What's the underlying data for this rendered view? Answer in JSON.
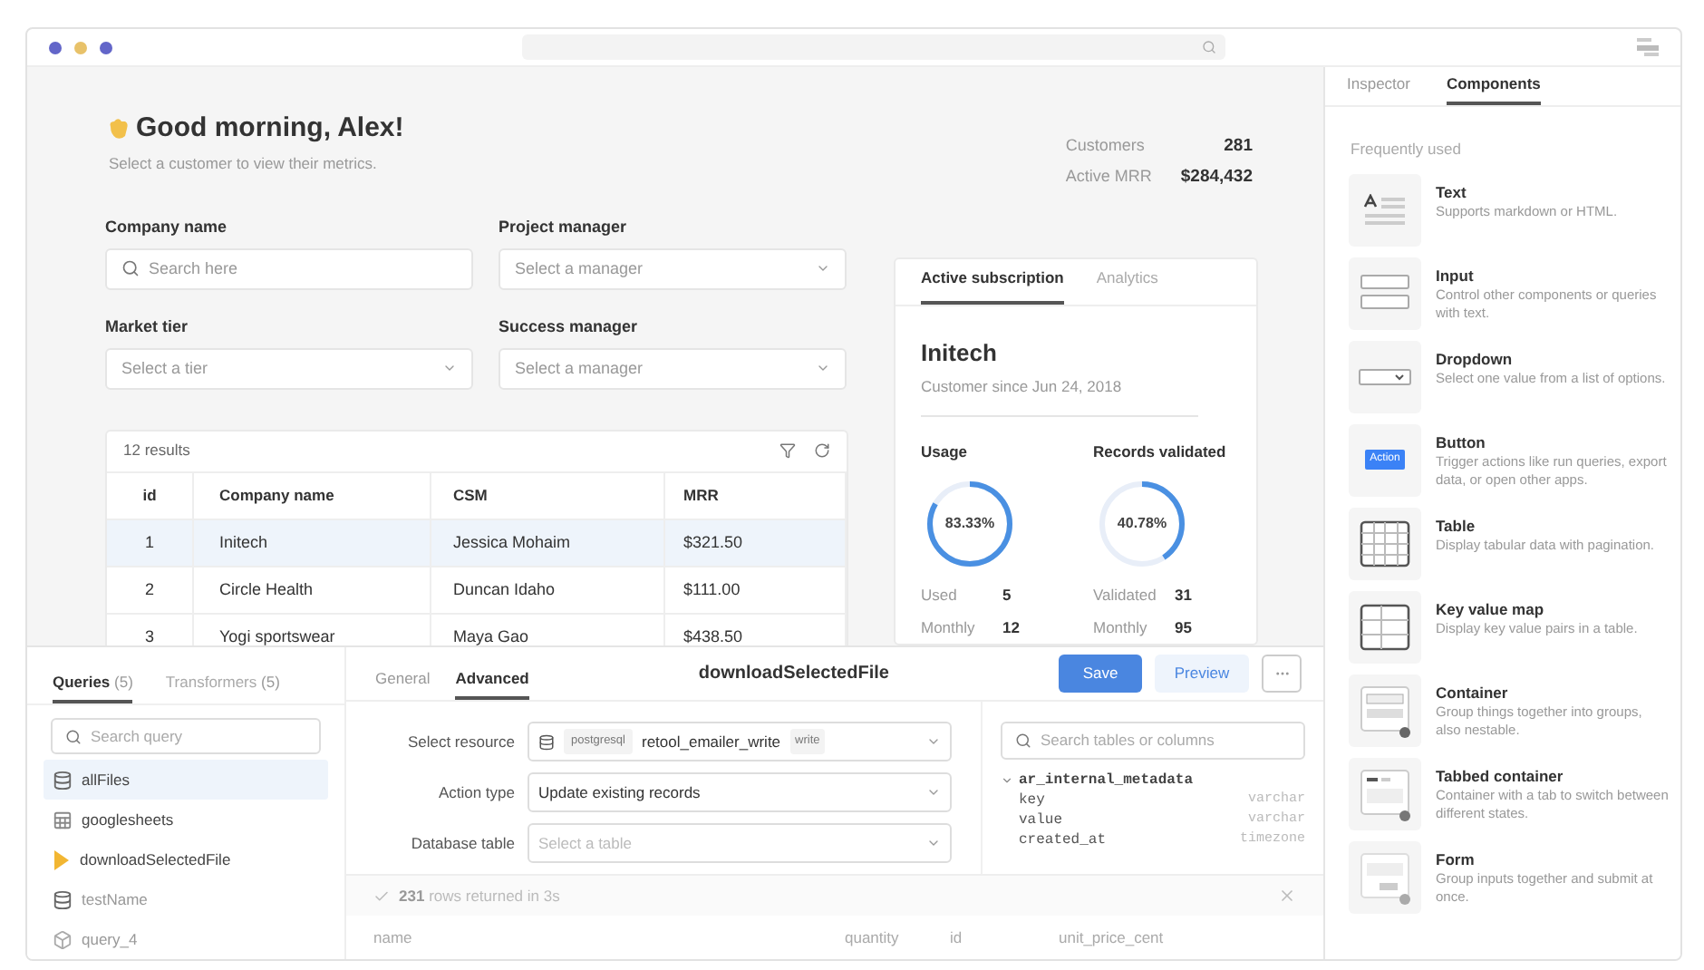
{
  "greeting": {
    "title": "Good morning, Alex!",
    "subtitle": "Select a customer to view their metrics."
  },
  "filters": [
    {
      "label": "Company name",
      "kind": "search",
      "placeholder": "Search here"
    },
    {
      "label": "Project manager",
      "kind": "select",
      "placeholder": "Select a manager"
    },
    {
      "label": "Market tier",
      "kind": "select",
      "placeholder": "Select a tier"
    },
    {
      "label": "Success manager",
      "kind": "select",
      "placeholder": "Select a manager"
    }
  ],
  "stats": [
    {
      "label": "Customers",
      "value": "281"
    },
    {
      "label": "Active MRR",
      "value": "$284,432"
    }
  ],
  "table": {
    "count": "12 results",
    "columns": [
      "id",
      "Company name",
      "CSM",
      "MRR"
    ],
    "rows": [
      {
        "cells": [
          "1",
          "Initech",
          "Jessica Mohaim",
          "$321.50"
        ],
        "selected": true
      },
      {
        "cells": [
          "2",
          "Circle Health",
          "Duncan Idaho",
          "$111.00"
        ],
        "selected": false
      },
      {
        "cells": [
          "3",
          "Yogi sportswear",
          "Maya Gao",
          "$438.50"
        ],
        "selected": false
      }
    ]
  },
  "subscription_card": {
    "tabs": [
      {
        "label": "Active subscription",
        "selected": true
      },
      {
        "label": "Analytics",
        "selected": false
      }
    ],
    "company": "Initech",
    "since": "Customer since Jun 24, 2018",
    "metrics": [
      {
        "title": "Usage",
        "reading": "83.33%",
        "level": 0.8333,
        "stats": [
          {
            "label": "Used",
            "value": "5"
          },
          {
            "label": "Monthly",
            "value": "12"
          }
        ]
      },
      {
        "title": "Records validated",
        "reading": "40.78%",
        "level": 0.4078,
        "stats": [
          {
            "label": "Validated",
            "value": "31"
          },
          {
            "label": "Monthly",
            "value": "95"
          }
        ]
      }
    ]
  },
  "query_panel": {
    "tabs": [
      {
        "label": "Queries",
        "count": "(5)",
        "selected": true
      },
      {
        "label": "Transformers",
        "count": "(5)",
        "selected": false
      }
    ],
    "search": {
      "placeholder": "Search query"
    },
    "queries": [
      {
        "name": "allFiles",
        "kind": "postgres",
        "selected": true
      },
      {
        "name": "googlesheets",
        "kind": "sheets",
        "selected": false
      },
      {
        "name": "downloadSelectedFile",
        "kind": "javascript",
        "selected": false
      },
      {
        "name": "testName",
        "kind": "postgres",
        "selected": false
      },
      {
        "name": "query_4",
        "kind": "generic",
        "selected": false
      }
    ]
  },
  "editor": {
    "tabs": [
      {
        "label": "General",
        "selected": false
      },
      {
        "label": "Advanced",
        "selected": true
      }
    ],
    "title": "downloadSelectedFile",
    "buttons": [
      {
        "label": "Save",
        "kind": "primary"
      },
      {
        "label": "Preview",
        "kind": "secondary"
      }
    ],
    "fields": [
      {
        "label": "Select resource",
        "kind": "resource",
        "badge": "postgresql",
        "value": "retool_emailer_write",
        "tag": "write"
      },
      {
        "label": "Action type",
        "kind": "select",
        "value": "Update existing records"
      },
      {
        "label": "Database table",
        "kind": "select",
        "placeholder": "Select a table"
      }
    ]
  },
  "schema": {
    "search": {
      "placeholder": "Search tables or columns"
    },
    "tables": [
      {
        "name": "ar_internal_metadata",
        "expanded": true,
        "children": [
          {
            "name": "key",
            "type": "varchar"
          },
          {
            "name": "value",
            "type": "varchar"
          },
          {
            "name": "created_at",
            "type": "timezone"
          }
        ]
      }
    ]
  },
  "results": {
    "count": "231",
    "text": "rows returned in 3s",
    "columns": [
      "name",
      "quantity",
      "id",
      "unit_price_cent"
    ]
  },
  "inspector": {
    "tabs": [
      {
        "label": "Inspector",
        "selected": false
      },
      {
        "label": "Components",
        "selected": true
      }
    ],
    "section": "Frequently used",
    "components": [
      {
        "name": "Text",
        "description": "Supports markdown or HTML.",
        "kind": "text"
      },
      {
        "name": "Input",
        "description": "Control other components or queries with text.",
        "kind": "input"
      },
      {
        "name": "Dropdown",
        "description": "Select one value from a list of options.",
        "kind": "dropdown"
      },
      {
        "name": "Button",
        "description": "Trigger actions like run queries, export data, or open other apps.",
        "kind": "button",
        "icon_label": "Action"
      },
      {
        "name": "Table",
        "description": "Display tabular data with pagination.",
        "kind": "table"
      },
      {
        "name": "Key value map",
        "description": "Display key value pairs in a table.",
        "kind": "keyvalue"
      },
      {
        "name": "Container",
        "description": "Group things together into groups, also nestable.",
        "kind": "container"
      },
      {
        "name": "Tabbed container",
        "description": "Container with a tab to switch between different states.",
        "kind": "tabbed"
      },
      {
        "name": "Form",
        "description": "Group inputs together and submit at once.",
        "kind": "form"
      }
    ]
  }
}
